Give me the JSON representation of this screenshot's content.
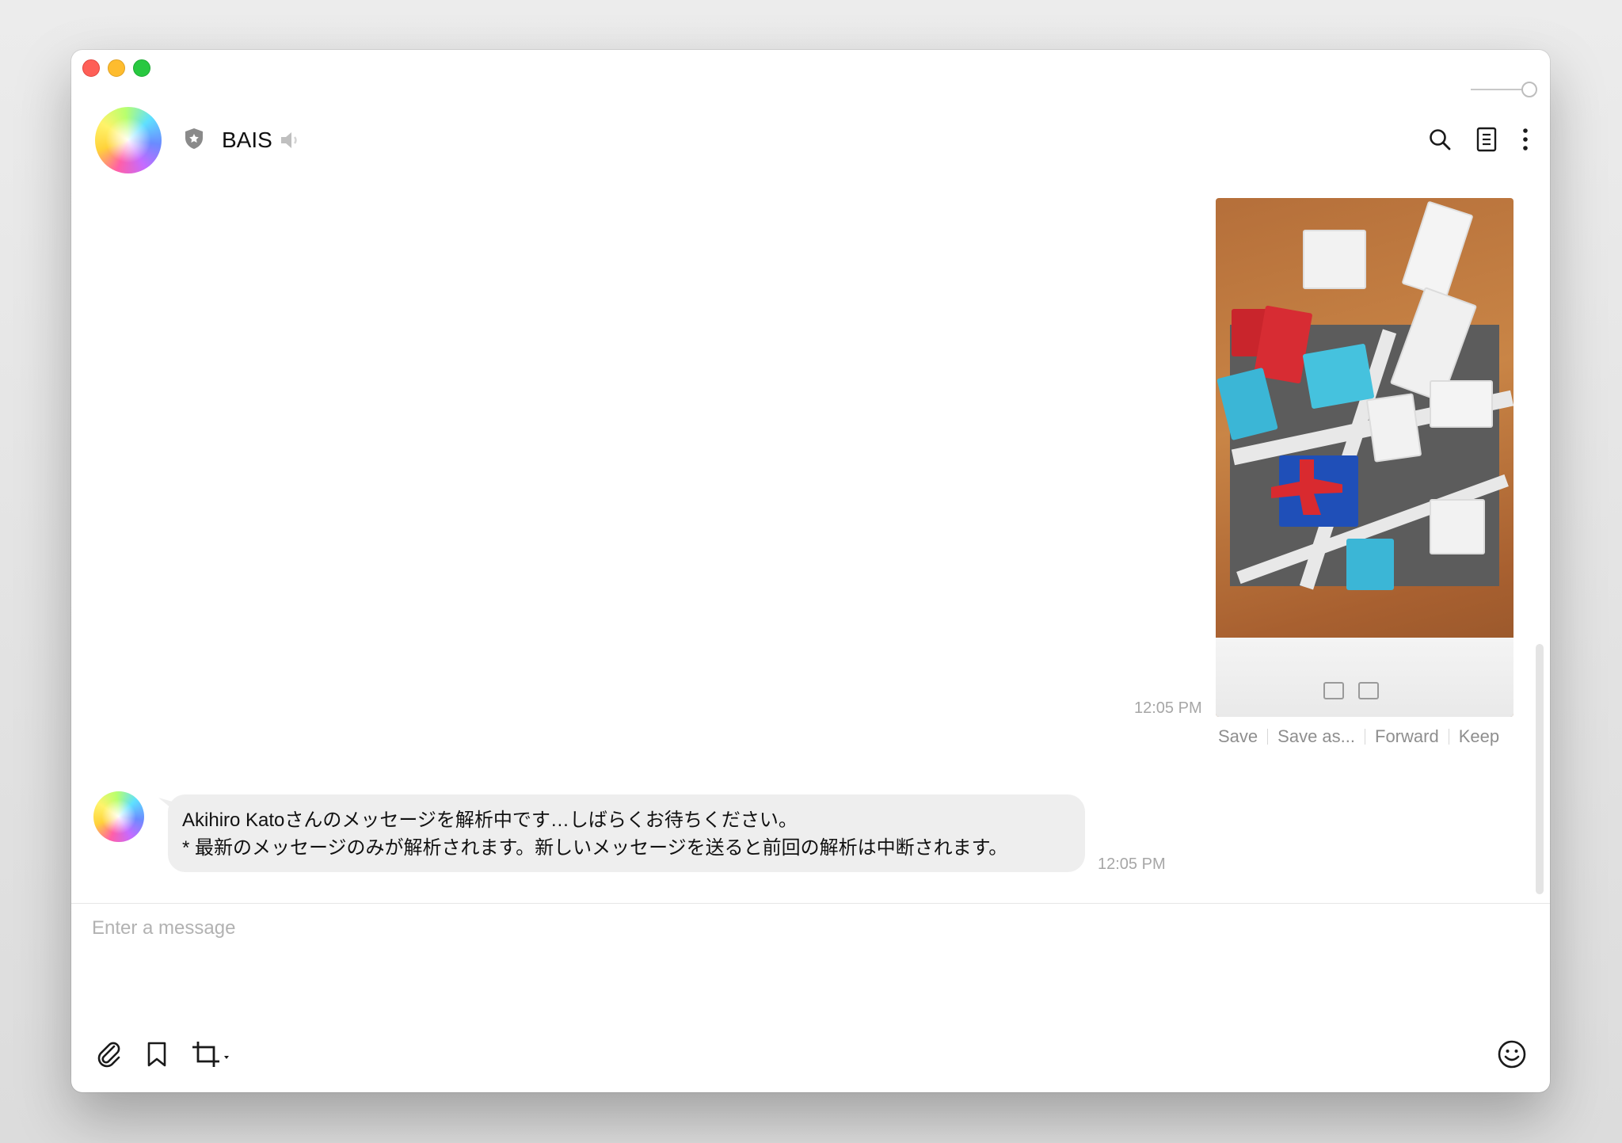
{
  "chat": {
    "title": "BAIS"
  },
  "messages": {
    "image_message": {
      "timestamp": "12:05 PM"
    },
    "image_actions": {
      "save": "Save",
      "save_as": "Save as...",
      "forward": "Forward",
      "keep": "Keep"
    },
    "reply": {
      "line1": "Akihiro Katoさんのメッセージを解析中です…しばらくお待ちください。",
      "line2": "* 最新のメッセージのみが解析されます。新しいメッセージを送ると前回の解析は中断されます。",
      "timestamp": "12:05 PM"
    }
  },
  "composer": {
    "placeholder": "Enter a message"
  },
  "icons": {
    "header": [
      "shield-icon",
      "mute-icon",
      "search-icon",
      "notes-icon",
      "more-icon"
    ],
    "toolbar": [
      "paperclip-icon",
      "bookmark-icon",
      "crop-icon",
      "emoji-icon"
    ]
  },
  "colors": {
    "bubble": "#eeeeee",
    "timestamp": "#a6a6a6",
    "accent_close": "#fe5f57",
    "accent_min": "#febc2e",
    "accent_max": "#28c840"
  }
}
